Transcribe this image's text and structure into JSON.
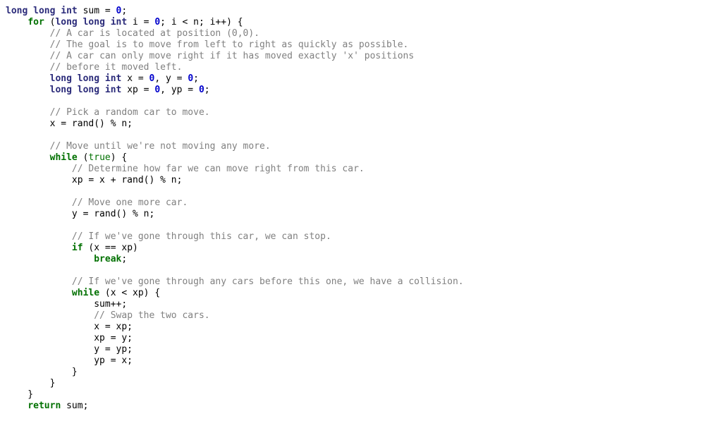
{
  "code": {
    "lines": [
      [
        {
          "t": "long long int",
          "c": "type"
        },
        {
          "t": " sum = ",
          "c": "plain"
        },
        {
          "t": "0",
          "c": "num"
        },
        {
          "t": ";",
          "c": "plain"
        }
      ],
      [
        {
          "t": "    ",
          "c": "plain"
        },
        {
          "t": "for",
          "c": "ctrl"
        },
        {
          "t": " (",
          "c": "plain"
        },
        {
          "t": "long long int",
          "c": "type"
        },
        {
          "t": " i = ",
          "c": "plain"
        },
        {
          "t": "0",
          "c": "num"
        },
        {
          "t": "; i < n; i++) {",
          "c": "plain"
        }
      ],
      [
        {
          "t": "        ",
          "c": "plain"
        },
        {
          "t": "// A car is located at position (0,0).",
          "c": "comment"
        }
      ],
      [
        {
          "t": "        ",
          "c": "plain"
        },
        {
          "t": "// The goal is to move from left to right as quickly as possible.",
          "c": "comment"
        }
      ],
      [
        {
          "t": "        ",
          "c": "plain"
        },
        {
          "t": "// A car can only move right if it has moved exactly 'x' positions",
          "c": "comment"
        }
      ],
      [
        {
          "t": "        ",
          "c": "plain"
        },
        {
          "t": "// before it moved left.",
          "c": "comment"
        }
      ],
      [
        {
          "t": "        ",
          "c": "plain"
        },
        {
          "t": "long long int",
          "c": "type"
        },
        {
          "t": " x = ",
          "c": "plain"
        },
        {
          "t": "0",
          "c": "num"
        },
        {
          "t": ", y = ",
          "c": "plain"
        },
        {
          "t": "0",
          "c": "num"
        },
        {
          "t": ";",
          "c": "plain"
        }
      ],
      [
        {
          "t": "        ",
          "c": "plain"
        },
        {
          "t": "long long int",
          "c": "type"
        },
        {
          "t": " xp = ",
          "c": "plain"
        },
        {
          "t": "0",
          "c": "num"
        },
        {
          "t": ", yp = ",
          "c": "plain"
        },
        {
          "t": "0",
          "c": "num"
        },
        {
          "t": ";",
          "c": "plain"
        }
      ],
      [],
      [
        {
          "t": "        ",
          "c": "plain"
        },
        {
          "t": "// Pick a random car to move.",
          "c": "comment"
        }
      ],
      [
        {
          "t": "        x = rand() % n;",
          "c": "plain"
        }
      ],
      [],
      [
        {
          "t": "        ",
          "c": "plain"
        },
        {
          "t": "// Move until we're not moving any more.",
          "c": "comment"
        }
      ],
      [
        {
          "t": "        ",
          "c": "plain"
        },
        {
          "t": "while",
          "c": "ctrl"
        },
        {
          "t": " (",
          "c": "plain"
        },
        {
          "t": "true",
          "c": "bool"
        },
        {
          "t": ") {",
          "c": "plain"
        }
      ],
      [
        {
          "t": "            ",
          "c": "plain"
        },
        {
          "t": "// Determine how far we can move right from this car.",
          "c": "comment"
        }
      ],
      [
        {
          "t": "            xp = x + rand() % n;",
          "c": "plain"
        }
      ],
      [],
      [
        {
          "t": "            ",
          "c": "plain"
        },
        {
          "t": "// Move one more car.",
          "c": "comment"
        }
      ],
      [
        {
          "t": "            y = rand() % n;",
          "c": "plain"
        }
      ],
      [],
      [
        {
          "t": "            ",
          "c": "plain"
        },
        {
          "t": "// If we've gone through this car, we can stop.",
          "c": "comment"
        }
      ],
      [
        {
          "t": "            ",
          "c": "plain"
        },
        {
          "t": "if",
          "c": "ctrl"
        },
        {
          "t": " (x == xp)",
          "c": "plain"
        }
      ],
      [
        {
          "t": "                ",
          "c": "plain"
        },
        {
          "t": "break",
          "c": "ctrl"
        },
        {
          "t": ";",
          "c": "plain"
        }
      ],
      [],
      [
        {
          "t": "            ",
          "c": "plain"
        },
        {
          "t": "// If we've gone through any cars before this one, we have a collision.",
          "c": "comment"
        }
      ],
      [
        {
          "t": "            ",
          "c": "plain"
        },
        {
          "t": "while",
          "c": "ctrl"
        },
        {
          "t": " (x < xp) {",
          "c": "plain"
        }
      ],
      [
        {
          "t": "                sum++;",
          "c": "plain"
        }
      ],
      [
        {
          "t": "                ",
          "c": "plain"
        },
        {
          "t": "// Swap the two cars.",
          "c": "comment"
        }
      ],
      [
        {
          "t": "                x = xp;",
          "c": "plain"
        }
      ],
      [
        {
          "t": "                xp = y;",
          "c": "plain"
        }
      ],
      [
        {
          "t": "                y = yp;",
          "c": "plain"
        }
      ],
      [
        {
          "t": "                yp = x;",
          "c": "plain"
        }
      ],
      [
        {
          "t": "            }",
          "c": "plain"
        }
      ],
      [
        {
          "t": "        }",
          "c": "plain"
        }
      ],
      [
        {
          "t": "    }",
          "c": "plain"
        }
      ],
      [
        {
          "t": "    ",
          "c": "plain"
        },
        {
          "t": "return",
          "c": "ctrl"
        },
        {
          "t": " sum;",
          "c": "plain"
        }
      ]
    ]
  }
}
